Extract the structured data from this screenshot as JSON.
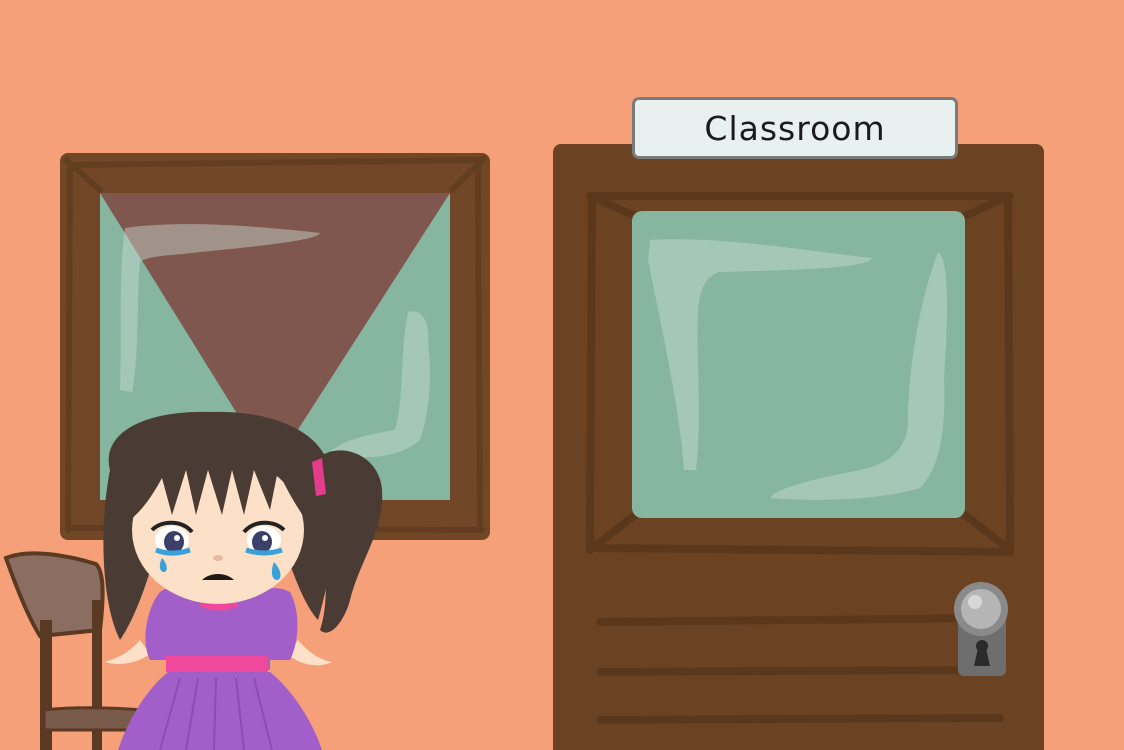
{
  "scene": {
    "sign_label": "Classroom"
  },
  "colors": {
    "wall": "#f6a079",
    "wood": "#6a4222",
    "glass": "#86b5a0",
    "dress": "#a35fc9",
    "sash": "#f0489b"
  },
  "icons": {
    "door_handle": "door-knob-icon",
    "keyhole": "keyhole-icon"
  }
}
